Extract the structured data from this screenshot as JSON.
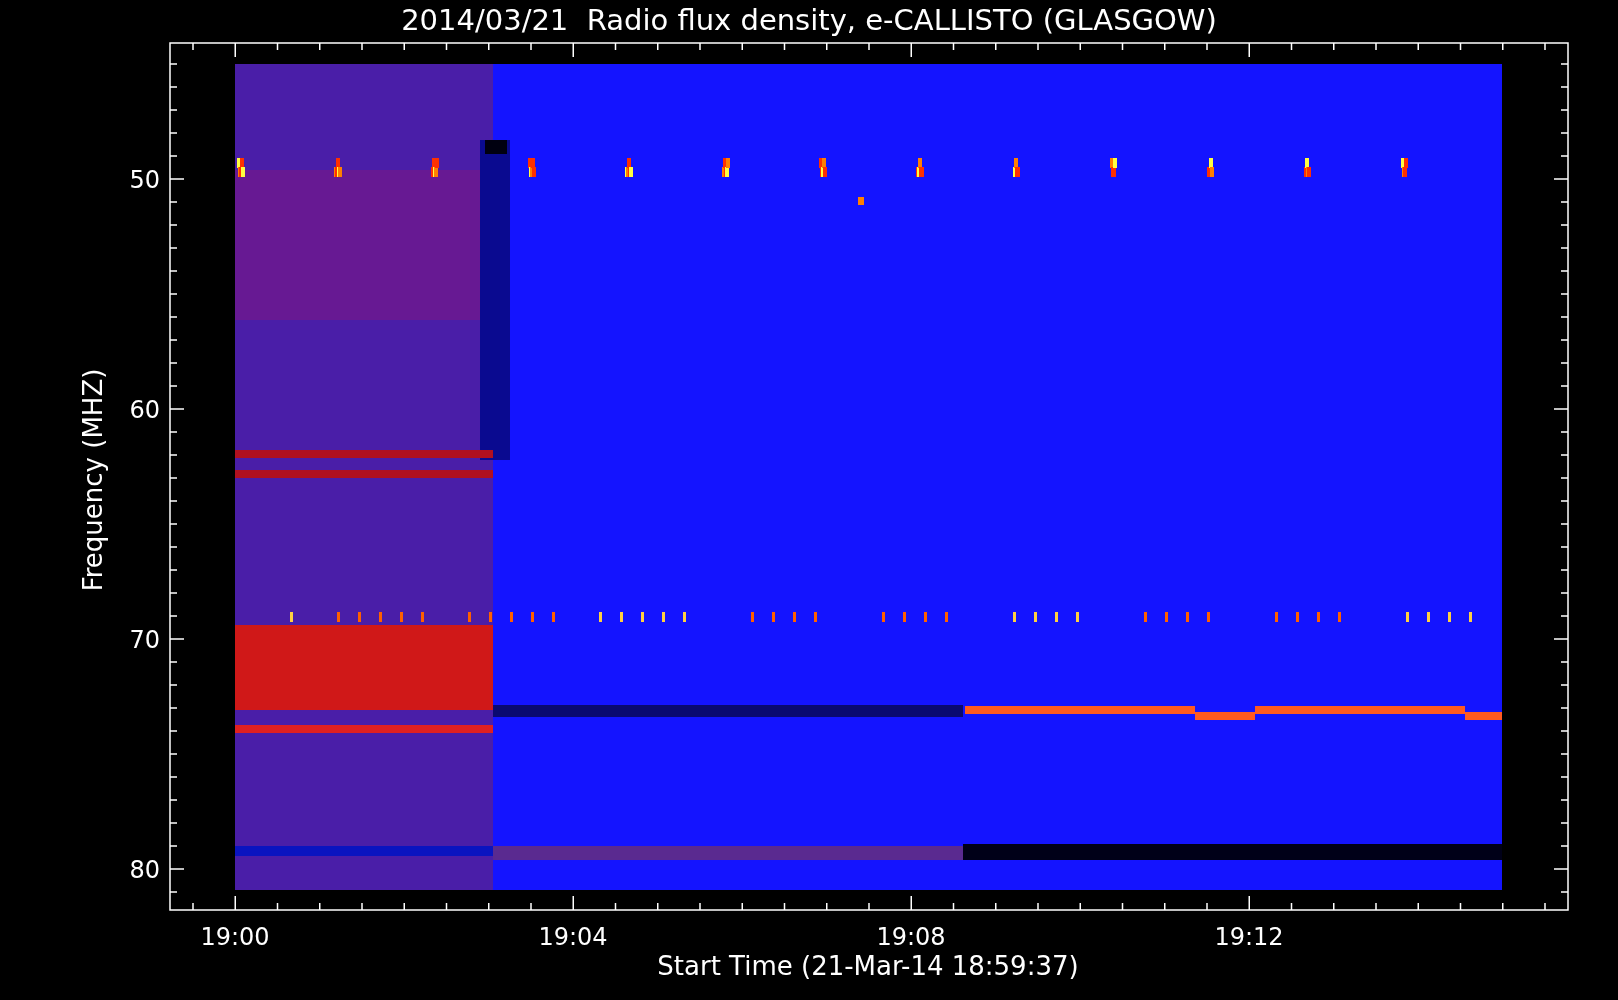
{
  "title": "2014/03/21  Radio flux density, e-CALLISTO (GLASGOW)",
  "x_axis": {
    "label": "Start Time (21-Mar-14 18:59:37)",
    "ticks": [
      "19:00",
      "19:04",
      "19:08",
      "19:12"
    ]
  },
  "y_axis": {
    "label": "Frequency (MHZ)",
    "ticks": [
      "50",
      "60",
      "70",
      "80"
    ]
  }
}
